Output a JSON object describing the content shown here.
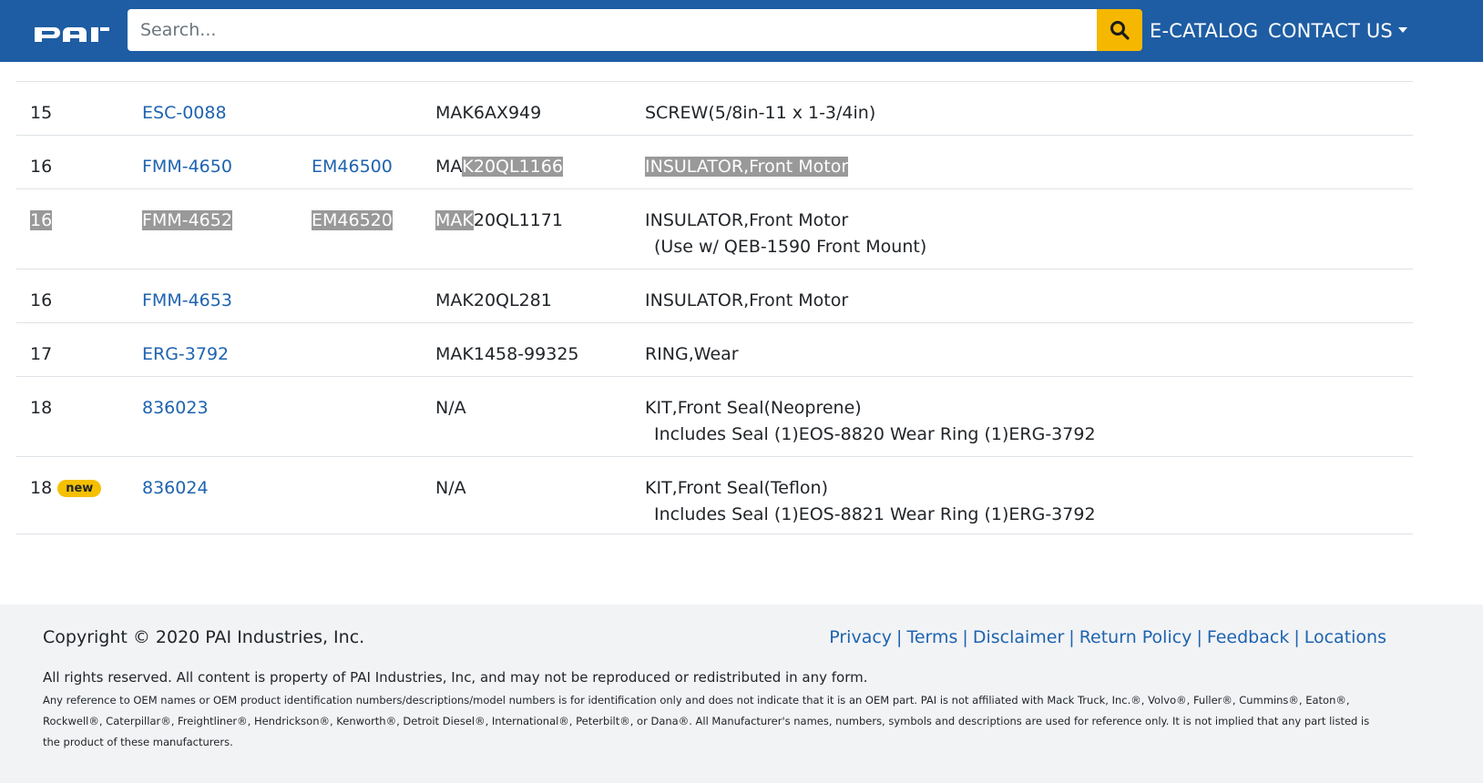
{
  "header": {
    "logo_text": "PAI",
    "search_placeholder": "Search...",
    "nav": {
      "ecatalog": "E-CATALOG",
      "contact": "CONTACT US"
    }
  },
  "table": {
    "rows": [
      {
        "item": "15",
        "badge": "",
        "part": "ESC-0088",
        "alt": "",
        "oem": "MAK6AX949",
        "desc": "SCREW(5/8in-11 x 1-3/4in)",
        "desc2": ""
      },
      {
        "item": "16",
        "badge": "",
        "part": "FMM-4650",
        "alt": "EM46500",
        "oem": "MAK20QL1166",
        "desc": "INSULATOR,Front Motor",
        "desc2": ""
      },
      {
        "item": "16",
        "badge": "",
        "part": "FMM-4652",
        "alt": "EM46520",
        "oem": "MAK20QL1171",
        "desc": "INSULATOR,Front Motor",
        "desc2": "(Use w/ QEB-1590 Front Mount)"
      },
      {
        "item": "16",
        "badge": "",
        "part": "FMM-4653",
        "alt": "",
        "oem": "MAK20QL281",
        "desc": "INSULATOR,Front Motor",
        "desc2": ""
      },
      {
        "item": "17",
        "badge": "",
        "part": "ERG-3792",
        "alt": "",
        "oem": "MAK1458-99325",
        "desc": "RING,Wear",
        "desc2": ""
      },
      {
        "item": "18",
        "badge": "",
        "part": "836023",
        "alt": "",
        "oem": "N/A",
        "desc": "KIT,Front Seal(Neoprene)",
        "desc2": "Includes Seal (1)EOS-8820 Wear Ring (1)ERG-3792"
      },
      {
        "item": "18",
        "badge": "new",
        "part": "836024",
        "alt": "",
        "oem": "N/A",
        "desc": "KIT,Front Seal(Teflon)",
        "desc2": "Includes Seal (1)EOS-8821 Wear Ring (1)ERG-3792"
      }
    ]
  },
  "highlight_parts": {
    "row1_oem_plain": "MA",
    "row1_oem_hl": "K20QL1166",
    "row2_oem_hl": "MAK",
    "row2_oem_plain": "20QL1171"
  },
  "footer": {
    "copyright": "Copyright © 2020 PAI Industries, Inc.",
    "links": [
      "Privacy",
      "Terms",
      "Disclaimer",
      "Return Policy",
      "Feedback",
      "Locations"
    ],
    "rights": "All rights reserved. All content is property of PAI Industries, Inc, and may not be reproduced or redistributed in any form.",
    "disclaimer": "Any reference to OEM names or OEM product identification numbers/descriptions/model numbers is for identification only and does not indicate that it is an OEM part. PAI is not affiliated with Mack Truck, Inc.®, Volvo®, Fuller®, Cummins®, Eaton®, Rockwell®, Caterpillar®, Freightliner®, Hendrickson®, Kenworth®, Detroit Diesel®, International®, Peterbilt®, or Dana®. All Manufacturer's names, numbers, symbols and descriptions are used for reference only. It is not implied that any part listed is the product of these manufacturers."
  },
  "colors": {
    "header_bg": "#1e5da3",
    "search_button": "#f5b700",
    "link": "#1e63b0",
    "badge": "#f5c000",
    "footer_bg": "#f2f3f5",
    "highlight": "#999999"
  }
}
